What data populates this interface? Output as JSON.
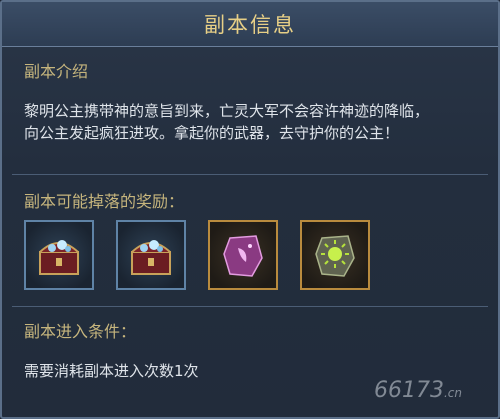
{
  "title": "副本信息",
  "intro": {
    "heading": "副本介绍",
    "lines": [
      "黎明公主携带神的意旨到来，亡灵大军不会容许神迹的降临，",
      "向公主发起疯狂进攻。拿起你的武器，去守护你的公主！"
    ]
  },
  "rewards": {
    "heading": "副本可能掉落的奖励：",
    "items": [
      {
        "icon": "treasure-chest-icon",
        "frame": "blue"
      },
      {
        "icon": "treasure-chest-icon",
        "frame": "blue"
      },
      {
        "icon": "purple-rune-stone-icon",
        "frame": "gold"
      },
      {
        "icon": "green-sun-rune-stone-icon",
        "frame": "gold"
      }
    ]
  },
  "entry": {
    "heading": "副本进入条件：",
    "text": "需要消耗副本进入次数1次"
  },
  "watermark": {
    "main": "66173",
    "suffix": ".cn"
  },
  "colors": {
    "heading": "#c6b57d",
    "title": "#e7cf86",
    "text": "#dfe4ea",
    "blue_frame": "#5f83a6",
    "gold_frame": "#b98b3e"
  }
}
